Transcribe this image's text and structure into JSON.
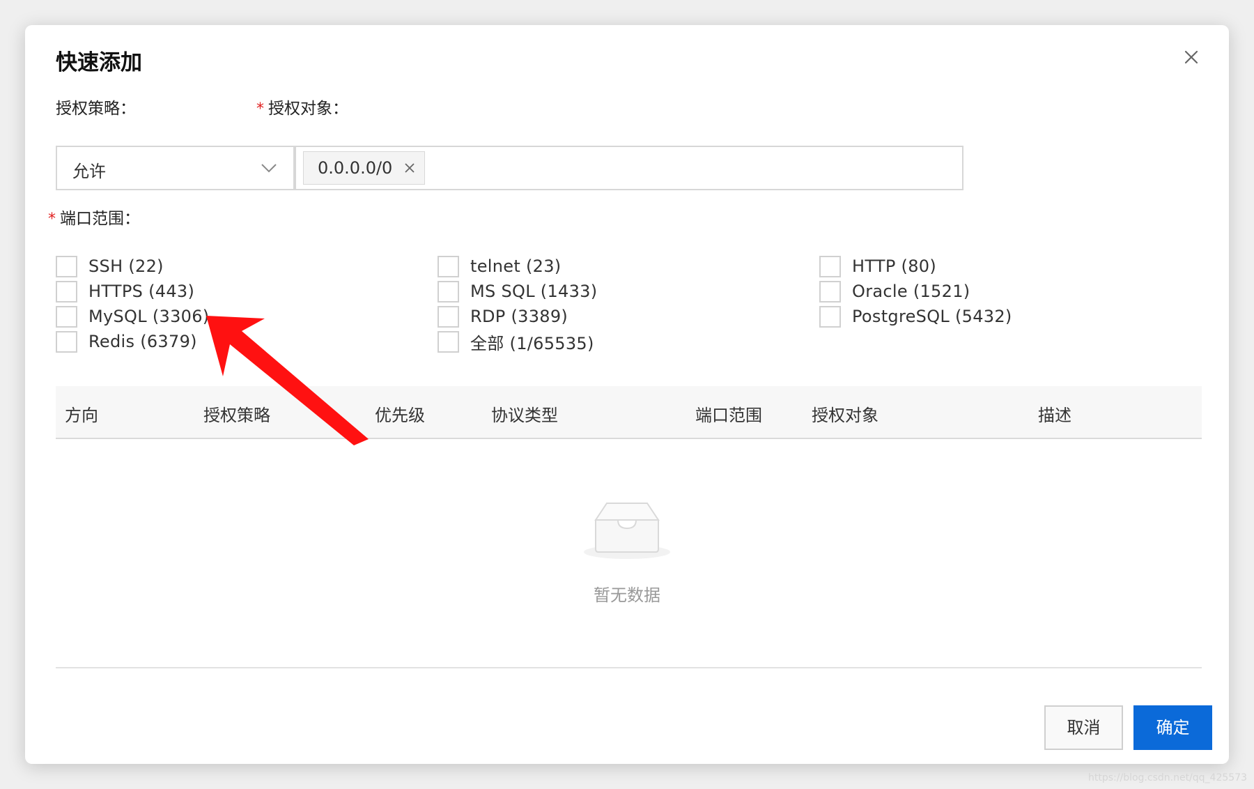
{
  "dialog": {
    "title": "快速添加",
    "close_icon": "close-icon"
  },
  "form": {
    "policy": {
      "label": "授权策略：",
      "value": "允许"
    },
    "target": {
      "required": "*",
      "label": "授权对象：",
      "tags": [
        "0.0.0.0/0"
      ]
    },
    "ports": {
      "required": "*",
      "label": "端口范围：",
      "options": [
        {
          "label": "SSH (22)",
          "checked": false
        },
        {
          "label": "telnet (23)",
          "checked": false
        },
        {
          "label": "HTTP (80)",
          "checked": false
        },
        {
          "label": "HTTPS (443)",
          "checked": false
        },
        {
          "label": "MS SQL (1433)",
          "checked": false
        },
        {
          "label": "Oracle (1521)",
          "checked": false
        },
        {
          "label": "MySQL (3306)",
          "checked": false
        },
        {
          "label": "RDP (3389)",
          "checked": false
        },
        {
          "label": "PostgreSQL (5432)",
          "checked": false
        },
        {
          "label": "Redis (6379)",
          "checked": false
        },
        {
          "label": "全部 (1/65535)",
          "checked": false
        }
      ]
    }
  },
  "table": {
    "columns": [
      "方向",
      "授权策略",
      "优先级",
      "协议类型",
      "端口范围",
      "授权对象",
      "描述"
    ],
    "empty_text": "暂无数据"
  },
  "footer": {
    "cancel_label": "取消",
    "confirm_label": "确定"
  },
  "colors": {
    "primary": "#0b6ad9",
    "required": "#e02020",
    "annotation": "#ff1111"
  },
  "watermark": "https://blog.csdn.net/qq_425573"
}
